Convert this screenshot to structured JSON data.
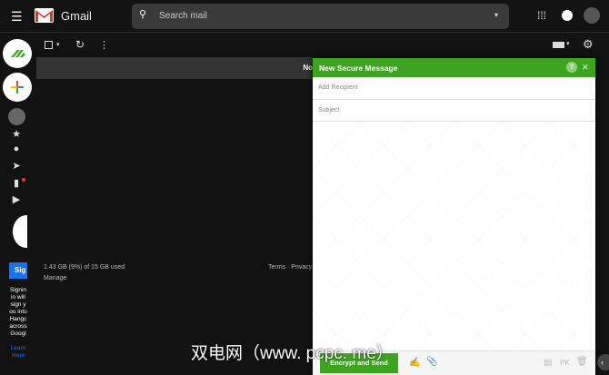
{
  "header": {
    "app_name": "Gmail",
    "search_placeholder": "Search mail"
  },
  "banner": {
    "text": "No"
  },
  "footer": {
    "storage": "1.43 GB (9%) of 15 GB used",
    "manage": "Manage",
    "terms": "Terms · Privacy"
  },
  "hangouts": {
    "signin_button": "Sig",
    "message": "Signin in will sign you into Hangc across Googl",
    "learn_more": "Learn more"
  },
  "compose": {
    "title": "New Secure Message",
    "recipient_placeholder": "Add Recipient",
    "subject_placeholder": "Subject",
    "send_label": "Encrypt and Send",
    "pk_label": "PK"
  },
  "watermark": "双电网（www. pcpc. me）",
  "colors": {
    "accent": "#3ea320"
  }
}
